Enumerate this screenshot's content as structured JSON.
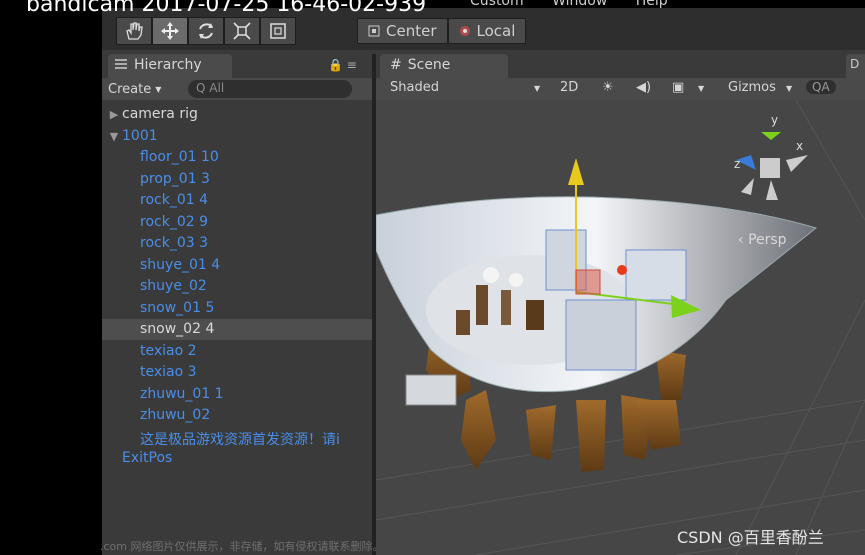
{
  "overlay": {
    "title": "bandicam 2017-07-25 16-46-02-939"
  },
  "menubar": [
    "Custom",
    "Window",
    "Help"
  ],
  "toolbar": {
    "tools": [
      "hand-icon",
      "move-icon",
      "rotate-icon",
      "scale-icon",
      "rect-icon"
    ],
    "center_label": "Center",
    "local_label": "Local"
  },
  "hierarchy": {
    "tab_label": "Hierarchy",
    "create_label": "Create",
    "search_placeholder": "All",
    "items": [
      {
        "label": "camera rig",
        "depth": 0,
        "color": "white",
        "arrow": "▶"
      },
      {
        "label": "1001",
        "depth": 0,
        "color": "blue",
        "arrow": "▼"
      },
      {
        "label": "floor_01 10",
        "depth": 1,
        "color": "blue"
      },
      {
        "label": "prop_01 3",
        "depth": 1,
        "color": "blue"
      },
      {
        "label": "rock_01 4",
        "depth": 1,
        "color": "blue"
      },
      {
        "label": "rock_02 9",
        "depth": 1,
        "color": "blue"
      },
      {
        "label": "rock_03 3",
        "depth": 1,
        "color": "blue"
      },
      {
        "label": "shuye_01 4",
        "depth": 1,
        "color": "blue"
      },
      {
        "label": "shuye_02",
        "depth": 1,
        "color": "blue"
      },
      {
        "label": "snow_01 5",
        "depth": 1,
        "color": "blue"
      },
      {
        "label": "snow_02 4",
        "depth": 1,
        "color": "white",
        "selected": true
      },
      {
        "label": "texiao 2",
        "depth": 1,
        "color": "blue"
      },
      {
        "label": "texiao 3",
        "depth": 1,
        "color": "blue"
      },
      {
        "label": "zhuwu_01 1",
        "depth": 1,
        "color": "blue"
      },
      {
        "label": "zhuwu_02",
        "depth": 1,
        "color": "blue"
      },
      {
        "label": "这是极品游戏资源首发资源！请i",
        "depth": 1,
        "color": "blue"
      },
      {
        "label": "ExitPos",
        "depth": 0,
        "color": "blue"
      }
    ]
  },
  "scene": {
    "tab_label": "Scene",
    "shading_mode": "Shaded",
    "mode_2d": "2D",
    "gizmos_label": "Gizmos",
    "search_placeholder": "A",
    "persp_label": "Persp",
    "axis_x": "x",
    "axis_y": "y",
    "axis_z": "z"
  },
  "right_panel": {
    "tab_label": "D"
  },
  "watermarks": {
    "bottom": ".com 网络图片仅供展示，非存储，如有侵权请联系删除。",
    "csdn": "CSDN @百里香酚兰"
  }
}
